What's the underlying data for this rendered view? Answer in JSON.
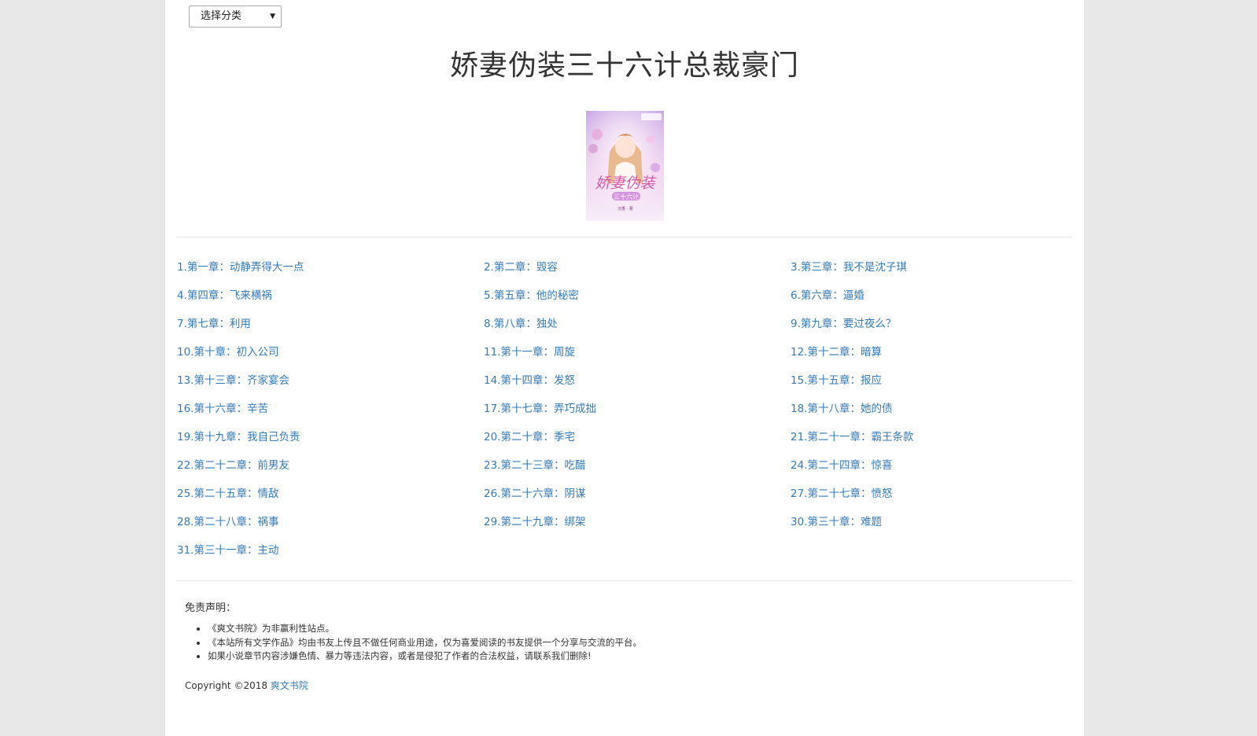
{
  "category_select": {
    "value": "选择分类"
  },
  "book": {
    "title": "娇妻伪装三十六计总裁豪门"
  },
  "chapters": [
    "1.第一章：动静弄得大一点",
    "2.第二章：毁容",
    "3.第三章：我不是沈子琪",
    "4.第四章：飞来横祸",
    "5.第五章：他的秘密",
    "6.第六章：逼婚",
    "7.第七章：利用",
    "8.第八章：独处",
    "9.第九章：要过夜么？",
    "10.第十章：初入公司",
    "11.第十一章：周旋",
    "12.第十二章：暗算",
    "13.第十三章：齐家宴会",
    "14.第十四章：发怒",
    "15.第十五章：报应",
    "16.第十六章：辛苦",
    "17.第十七章：弄巧成拙",
    "18.第十八章：她的债",
    "19.第十九章：我自己负责",
    "20.第二十章：季宅",
    "21.第二十一章：霸王条款",
    "22.第二十二章：前男友",
    "23.第二十三章：吃醋",
    "24.第二十四章：惊喜",
    "25.第二十五章：情敌",
    "26.第二十六章：阴谋",
    "27.第二十七章：愤怒",
    "28.第二十八章：祸事",
    "29.第二十九章：绑架",
    "30.第三十章：难题",
    "31.第三十一章：主动"
  ],
  "disclaimer": {
    "heading": "免责声明：",
    "items": [
      "《爽文书院》为非赢利性站点。",
      "《本站所有文学作品》均由书友上传且不做任何商业用途，仅为喜爱阅读的书友提供一个分享与交流的平台。",
      "如果小说章节内容涉嫌色情、暴力等违法内容，或者是侵犯了作者的合法权益，请联系我们删除!"
    ]
  },
  "footer": {
    "copyright_prefix": "Copyright ©2018 ",
    "site_link": "爽文书院"
  },
  "colors": {
    "link": "#337ab7",
    "background": "#e7e7e7",
    "panel": "#ffffff"
  }
}
